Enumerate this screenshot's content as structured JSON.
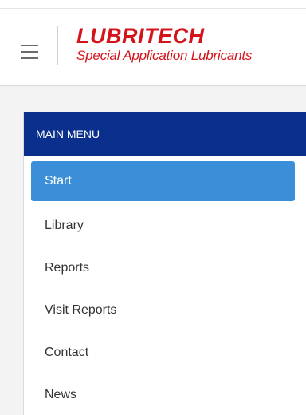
{
  "header": {
    "menu_icon": "hamburger-icon",
    "logo_title": "LUBRITECH",
    "logo_subtitle": "Special Application Lubricants",
    "brand_color": "#d4141b"
  },
  "menu": {
    "title": "MAIN MENU",
    "header_color": "#0a2f8c",
    "active_color": "#3b8fd9",
    "items": [
      {
        "label": "Start",
        "active": true
      },
      {
        "label": "Library",
        "active": false
      },
      {
        "label": "Reports",
        "active": false
      },
      {
        "label": "Visit Reports",
        "active": false
      },
      {
        "label": "Contact",
        "active": false
      },
      {
        "label": "News",
        "active": false
      }
    ]
  }
}
